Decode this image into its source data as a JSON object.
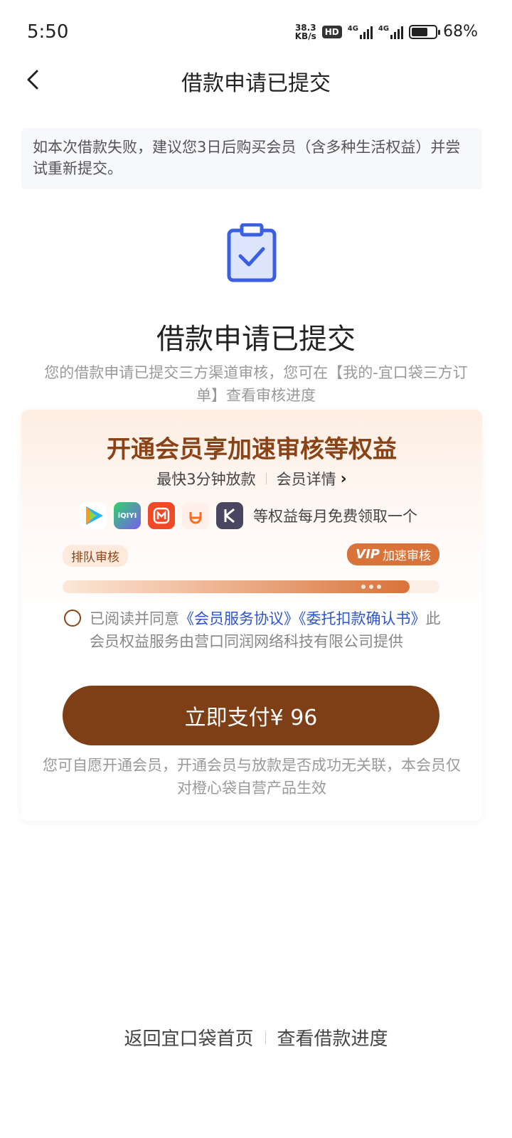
{
  "status_bar": {
    "time": "5:50",
    "net_speed_value": "38.3",
    "net_speed_unit": "KB/s",
    "hd_label": "HD",
    "signal1_label": "4G",
    "signal2_label": "4G",
    "battery_pct": "68%"
  },
  "nav": {
    "title": "借款申请已提交"
  },
  "notice": {
    "text": "如本次借款失败，建议您3日后购买会员（含多种生活权益）并尝试重新提交。"
  },
  "result": {
    "title": "借款申请已提交",
    "description": "您的借款申请已提交三方渠道审核，您可在【我的-宜口袋三方订单】查看审核进度"
  },
  "member_card": {
    "title": "开通会员享加速审核等权益",
    "fastest": "最快3分钟放款",
    "details_label": "会员详情",
    "perks_text": "等权益每月免费领取一个",
    "app_icons": [
      "tencent-video-icon",
      "iqiyi-icon",
      "mango-tv-icon",
      "didi-icon",
      "keep-icon"
    ],
    "iqiyi_label": "iQIYI",
    "queue_tag": "排队审核",
    "vip_label": "VIP",
    "vip_tag": "加速审核",
    "agree_prefix": "已阅读并同意",
    "agree_link": "《会员服务协议》《委托扣款确认书》",
    "agree_suffix": "此会员权益服务由营口同润网络科技有限公司提供",
    "pay_button": "立即支付¥ 96",
    "note": "您可自愿开通会员，开通会员与放款是否成功无关联，本会员仅对橙心袋自营产品生效",
    "accent_color": "#7e3f17"
  },
  "footer": {
    "home_link": "返回宜口袋首页",
    "progress_link": "查看借款进度"
  }
}
